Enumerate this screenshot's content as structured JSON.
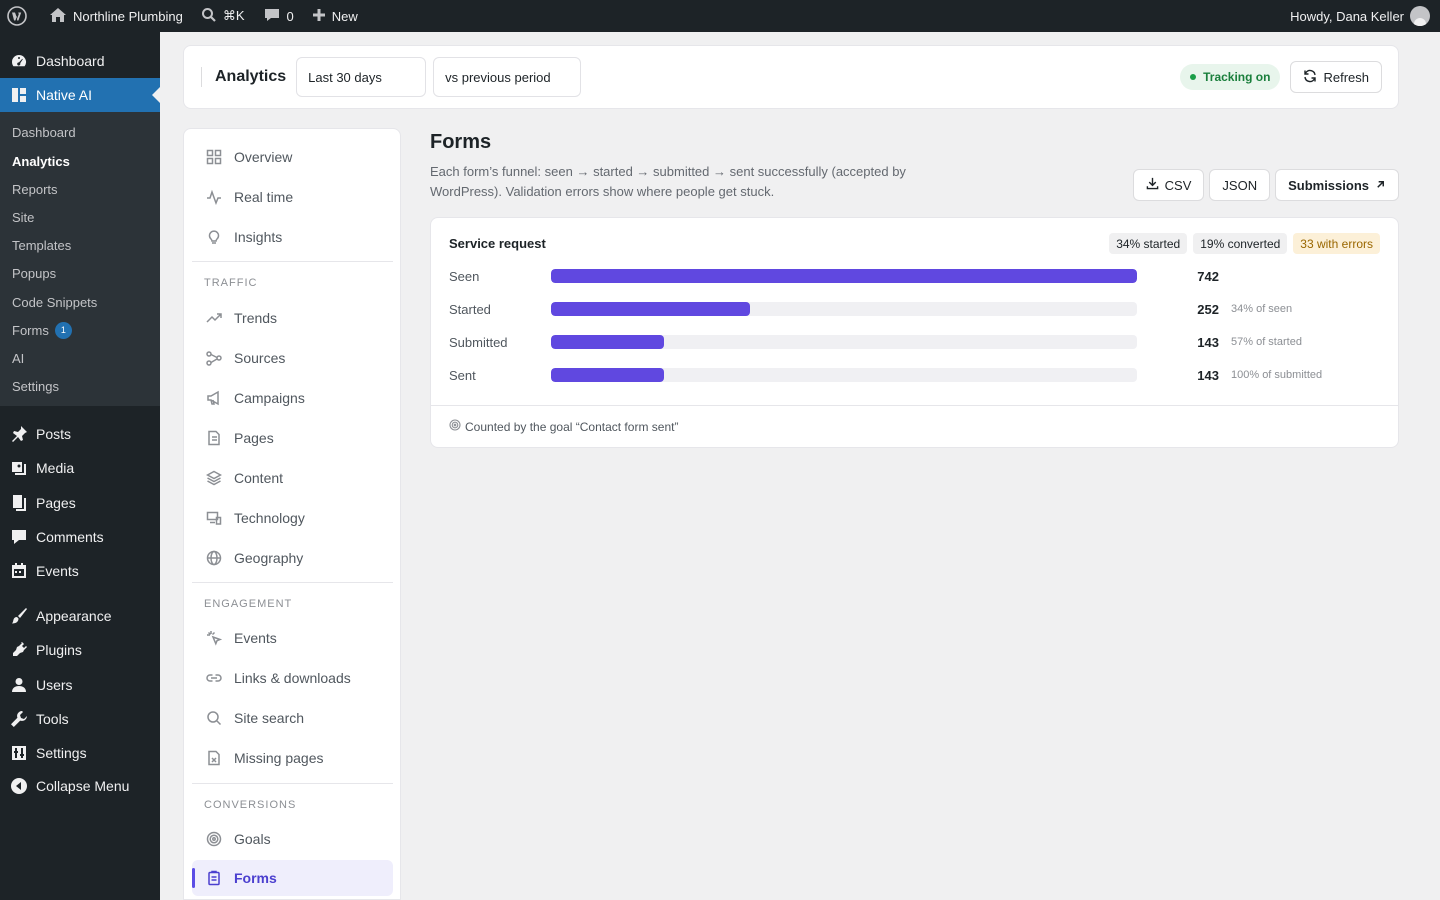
{
  "adminbar": {
    "site_name": "Northline Plumbing",
    "search_shortcut": "⌘K",
    "comments_count": "0",
    "new_label": "New",
    "greeting": "Howdy, Dana Keller"
  },
  "adminmenu": {
    "dashboard": "Dashboard",
    "native_ai": "Native AI",
    "submenu": [
      {
        "label": "Dashboard"
      },
      {
        "label": "Analytics"
      },
      {
        "label": "Reports"
      },
      {
        "label": "Site"
      },
      {
        "label": "Templates"
      },
      {
        "label": "Popups"
      },
      {
        "label": "Code Snippets"
      },
      {
        "label": "Forms",
        "badge": "1"
      },
      {
        "label": "AI"
      },
      {
        "label": "Settings"
      }
    ],
    "items": [
      {
        "label": "Posts"
      },
      {
        "label": "Media"
      },
      {
        "label": "Pages"
      },
      {
        "label": "Comments"
      },
      {
        "label": "Events"
      },
      {
        "label": "Appearance"
      },
      {
        "label": "Plugins"
      },
      {
        "label": "Users"
      },
      {
        "label": "Tools"
      },
      {
        "label": "Settings"
      },
      {
        "label": "Collapse Menu"
      }
    ]
  },
  "header": {
    "title": "Analytics",
    "range": "Last 30 days",
    "compare": "vs previous period",
    "tracking": "Tracking on",
    "refresh": "Refresh"
  },
  "nav": {
    "top": [
      {
        "label": "Overview"
      },
      {
        "label": "Real time"
      },
      {
        "label": "Insights"
      }
    ],
    "traffic_heading": "TRAFFIC",
    "traffic": [
      {
        "label": "Trends"
      },
      {
        "label": "Sources"
      },
      {
        "label": "Campaigns"
      },
      {
        "label": "Pages"
      },
      {
        "label": "Content"
      },
      {
        "label": "Technology"
      },
      {
        "label": "Geography"
      }
    ],
    "engagement_heading": "ENGAGEMENT",
    "engagement": [
      {
        "label": "Events"
      },
      {
        "label": "Links & downloads"
      },
      {
        "label": "Site search"
      },
      {
        "label": "Missing pages"
      }
    ],
    "conversions_heading": "CONVERSIONS",
    "conversions": [
      {
        "label": "Goals"
      },
      {
        "label": "Forms"
      }
    ]
  },
  "main": {
    "title": "Forms",
    "description": "Each form’s funnel: seen → started → submitted → sent successfully (accepted by WordPress). Validation errors show where people get stuck.",
    "csv": "CSV",
    "json": "JSON",
    "submissions": "Submissions"
  },
  "funnel": {
    "title": "Service request",
    "chips": {
      "started": "34% started",
      "converted": "19% converted",
      "errors": "33 with errors"
    },
    "rows": [
      {
        "label": "Seen",
        "value": "742",
        "fraction": 1.0,
        "pct": ""
      },
      {
        "label": "Started",
        "value": "252",
        "fraction": 0.34,
        "pct": "34% of seen"
      },
      {
        "label": "Submitted",
        "value": "143",
        "fraction": 0.193,
        "pct": "57% of started"
      },
      {
        "label": "Sent",
        "value": "143",
        "fraction": 0.193,
        "pct": "100% of submitted"
      }
    ],
    "footer": "Counted by the goal “Contact form sent”"
  },
  "colors": {
    "accent": "#6048e0",
    "wp_blue": "#2271b1",
    "admin_dark": "#1d2327"
  }
}
